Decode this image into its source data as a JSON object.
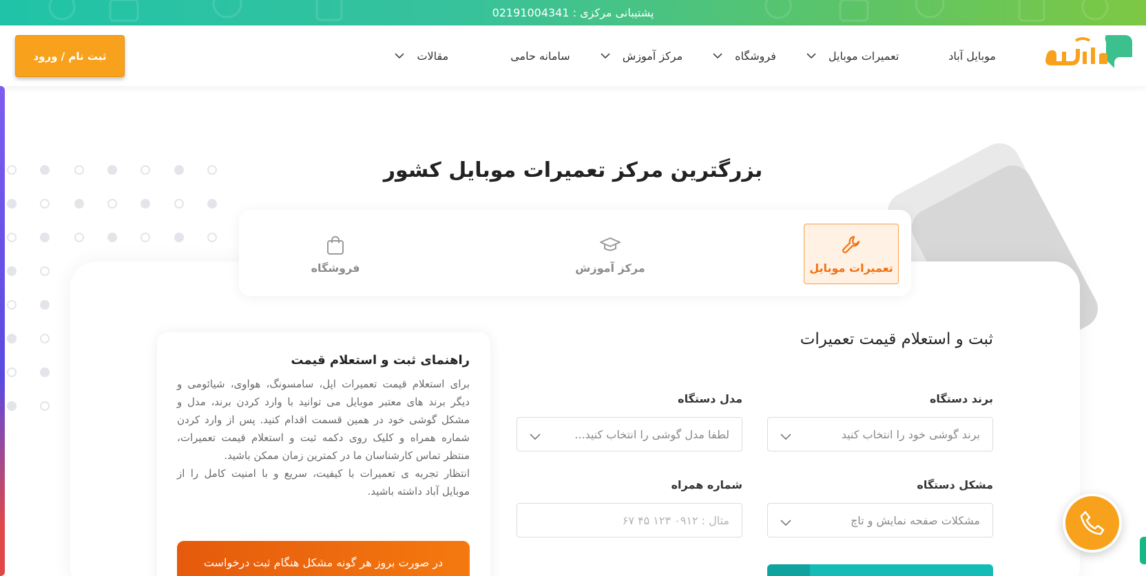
{
  "topbar": {
    "support_text": "پشتیبانی مرکزی : 02191004341"
  },
  "header": {
    "logo_alt": "موبایل آباد",
    "nav": [
      {
        "label": "موبایل آباد",
        "dropdown": false
      },
      {
        "label": "تعمیرات موبایل",
        "dropdown": true
      },
      {
        "label": "فروشگاه",
        "dropdown": true
      },
      {
        "label": "مرکز آموزش",
        "dropdown": true
      },
      {
        "label": "سامانه حامی",
        "dropdown": false
      },
      {
        "label": "مقالات",
        "dropdown": true
      }
    ],
    "auth_label": "ثبت نام / ورود"
  },
  "hero": {
    "title": "بزرگترین مرکز تعمیرات موبایل کشور"
  },
  "tabs": [
    {
      "label": "تعمیرات موبایل",
      "icon": "wrench-icon",
      "active": true
    },
    {
      "label": "مرکز آموزش",
      "icon": "graduation-cap-icon",
      "active": false
    },
    {
      "label": "فروشگاه",
      "icon": "shopping-bag-icon",
      "active": false
    }
  ],
  "form": {
    "title": "ثبت و استعلام قیمت تعمیرات",
    "brand": {
      "label": "برند دستگاه",
      "placeholder": "برند گوشی خود را انتخاب کنید"
    },
    "model": {
      "label": "مدل دستگاه",
      "placeholder": "لطفا مدل گوشی را انتخاب کنید..."
    },
    "problem": {
      "label": "مشکل دستگاه",
      "placeholder": "مشکلات صفحه نمایش و تاچ"
    },
    "phone": {
      "label": "شماره همراه",
      "placeholder": "مثال : ۰۹۱۲ ۱۲۳ ۴۵ ۶۷"
    }
  },
  "guide": {
    "title": "راهنمای ثبت و استعلام قیمت",
    "paragraph1": "برای استعلام قیمت تعمیرات اپل، سامسونگ، هواوی، شیائومی و دیگر برند های معتبر موبایل می توانید با وارد کردن برند، مدل و مشکل گوشی خود در همین قسمت اقدام کنید. پس از وارد کردن شماره همراه و کلیک روی دکمه ثبت و استعلام قیمت تعمیرات، منتظر تماس کارشناسان ما در کمترین زمان ممکن باشید.",
    "paragraph2": "انتظار تجربه ی تعمیرات با کیفیت، سریع و با امنیت کامل را از موبایل آباد داشته باشید.",
    "help_button": "در صورت بروز هر گونه مشکل هنگام ثبت درخواست"
  },
  "colors": {
    "accent": "#f7a11c",
    "brand_green": "#3cc08e",
    "orange_active": "#f07010",
    "teal": "#14bcb7"
  }
}
